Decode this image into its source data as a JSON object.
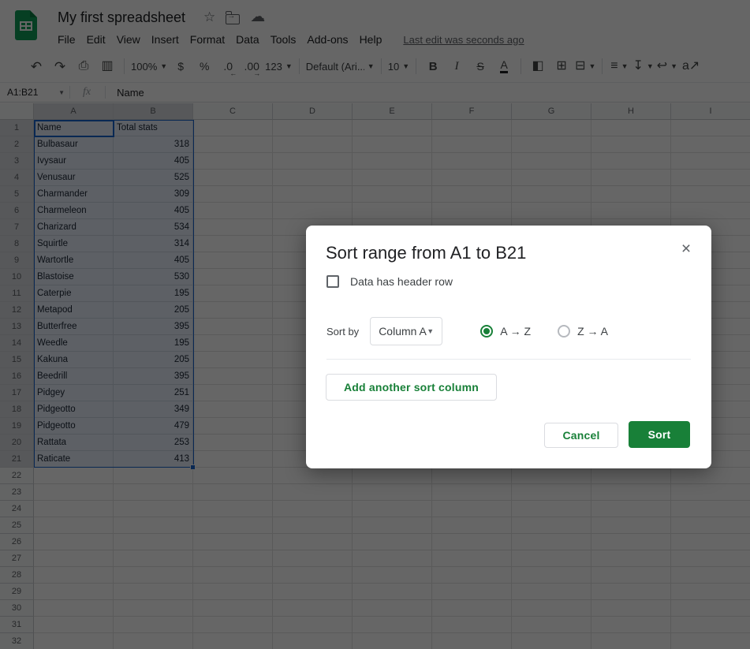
{
  "header": {
    "title": "My first spreadsheet",
    "title_icons": [
      "star-icon",
      "move-to-folder-icon",
      "cloud-status-icon"
    ],
    "menus": [
      "File",
      "Edit",
      "View",
      "Insert",
      "Format",
      "Data",
      "Tools",
      "Add-ons",
      "Help"
    ],
    "last_edit": "Last edit was seconds ago"
  },
  "toolbar": {
    "items": [
      {
        "name": "undo",
        "glyph": "↶",
        "cls": "g-undo"
      },
      {
        "name": "redo",
        "glyph": "↷",
        "cls": "g-redo"
      },
      {
        "name": "print",
        "glyph": "⎙",
        "cls": "g-print"
      },
      {
        "name": "paint-format",
        "glyph": "▥",
        "cls": "g-paint"
      },
      {
        "sep": true
      },
      {
        "name": "zoom",
        "glyph": "100%",
        "cls": "g-zoom",
        "dropdown": true
      },
      {
        "name": "format-as-currency",
        "glyph": "$"
      },
      {
        "name": "format-as-percent",
        "glyph": "%"
      },
      {
        "name": "decrease-decimal-places",
        "glyph": ".0",
        "sub": "←"
      },
      {
        "name": "increase-decimal-places",
        "glyph": ".00",
        "sub": "→"
      },
      {
        "name": "more-formats",
        "glyph": "123",
        "cls": "g-zoom",
        "dropdown": true
      },
      {
        "sep": true
      },
      {
        "name": "font",
        "glyph": "Default (Ari...",
        "cls": "g-font",
        "dropdown": true
      },
      {
        "sep": true
      },
      {
        "name": "font-size",
        "glyph": "10",
        "cls": "g-size",
        "dropdown": true
      },
      {
        "sep": true
      },
      {
        "name": "bold",
        "glyph": "B",
        "cls": "g-bold"
      },
      {
        "name": "italic",
        "glyph": "I",
        "cls": "g-italic"
      },
      {
        "name": "strikethrough",
        "glyph": "S",
        "cls": "g-strike"
      },
      {
        "name": "text-color",
        "glyph": "A",
        "cls": "g-tcolor"
      },
      {
        "sep": true
      },
      {
        "name": "fill-color",
        "glyph": "◧",
        "cls": "g-fill"
      },
      {
        "name": "borders",
        "glyph": "⊞",
        "cls": "g-borders"
      },
      {
        "name": "merge-cells",
        "glyph": "⊟",
        "cls": "g-merge",
        "dropdown": true
      },
      {
        "sep": true
      },
      {
        "name": "horizontal-align",
        "glyph": "≡",
        "cls": "g-align",
        "dropdown": true
      },
      {
        "name": "vertical-align",
        "glyph": "↧",
        "cls": "g-valign",
        "dropdown": true
      },
      {
        "name": "text-wrapping",
        "glyph": "↩",
        "cls": "g-wrap",
        "dropdown": true
      },
      {
        "name": "text-rotation",
        "glyph": "a↗",
        "cls": "g-rot"
      }
    ]
  },
  "formula_bar": {
    "name_box": "A1:B21",
    "fx": "fx",
    "value": "Name"
  },
  "sheet": {
    "columns": [
      "A",
      "B",
      "C",
      "D",
      "E",
      "F",
      "G",
      "H",
      "I"
    ],
    "row_count": 32,
    "selection": {
      "range": "A1:B21",
      "active_cell": "A1",
      "selected_columns": [
        "A",
        "B"
      ],
      "selected_rows_from": 1,
      "selected_rows_to": 21
    },
    "data": [
      [
        "Name",
        "Total stats"
      ],
      [
        "Bulbasaur",
        "318"
      ],
      [
        "Ivysaur",
        "405"
      ],
      [
        "Venusaur",
        "525"
      ],
      [
        "Charmander",
        "309"
      ],
      [
        "Charmeleon",
        "405"
      ],
      [
        "Charizard",
        "534"
      ],
      [
        "Squirtle",
        "314"
      ],
      [
        "Wartortle",
        "405"
      ],
      [
        "Blastoise",
        "530"
      ],
      [
        "Caterpie",
        "195"
      ],
      [
        "Metapod",
        "205"
      ],
      [
        "Butterfree",
        "395"
      ],
      [
        "Weedle",
        "195"
      ],
      [
        "Kakuna",
        "205"
      ],
      [
        "Beedrill",
        "395"
      ],
      [
        "Pidgey",
        "251"
      ],
      [
        "Pidgeotto",
        "349"
      ],
      [
        "Pidgeotto",
        "479"
      ],
      [
        "Rattata",
        "253"
      ],
      [
        "Raticate",
        "413"
      ]
    ]
  },
  "dialog": {
    "title": "Sort range from A1 to B21",
    "close": "×",
    "header_checkbox_label": "Data has header row",
    "header_checkbox_checked": false,
    "sort_by_label": "Sort by",
    "column_value": "Column A",
    "order_asc_label": "A → Z",
    "order_desc_label": "Z → A",
    "order_selected": "A → Z",
    "add_column_label": "Add another sort column",
    "cancel_label": "Cancel",
    "sort_label": "Sort"
  },
  "colors": {
    "sheets_logo_green": "#0f9d58",
    "selection_blue": "#1765cf",
    "button_green": "#188038",
    "scrim": "rgba(0,0,0,0.6)"
  }
}
